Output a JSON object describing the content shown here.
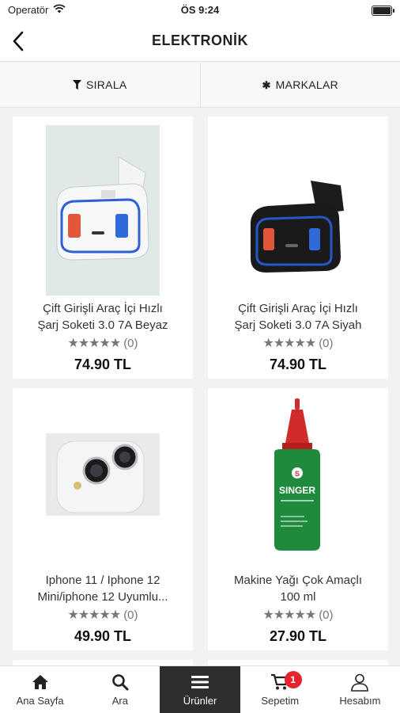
{
  "status_bar": {
    "carrier": "Operatör",
    "time": "ÖS 9:24"
  },
  "header": {
    "title": "ELEKTRONİK"
  },
  "filters": {
    "sort_label": "SIRALA",
    "brands_label": "MARKALAR"
  },
  "products": [
    {
      "name_line1": "Çift Girişli Araç İçi Hızlı",
      "name_line2": "Şarj Soketi 3.0 7A Beyaz",
      "rating_count": "(0)",
      "price": "74.90 TL",
      "image": "white-car-charger"
    },
    {
      "name_line1": "Çift Girişli Araç İçi Hızlı",
      "name_line2": "Şarj Soketi 3.0 7A Siyah",
      "rating_count": "(0)",
      "price": "74.90 TL",
      "image": "black-car-charger"
    },
    {
      "name_line1": "Iphone 11 / Iphone 12",
      "name_line2": "Mini/iphone 12 Uyumlu...",
      "rating_count": "(0)",
      "price": "49.90 TL",
      "image": "iphone-camera-lens-protector"
    },
    {
      "name_line1": "Makine Yağı Çok Amaçlı",
      "name_line2": "100 ml",
      "rating_count": "(0)",
      "price": "27.90 TL",
      "image": "singer-oil-bottle",
      "brand_text": "SINGER"
    }
  ],
  "nav": {
    "home": "Ana Sayfa",
    "search": "Ara",
    "products": "Ürünler",
    "cart": "Sepetim",
    "cart_badge": "1",
    "account": "Hesabım"
  },
  "colors": {
    "accent_dark": "#2e2e2e",
    "badge_red": "#e4232d",
    "background": "#f2f2f2"
  }
}
